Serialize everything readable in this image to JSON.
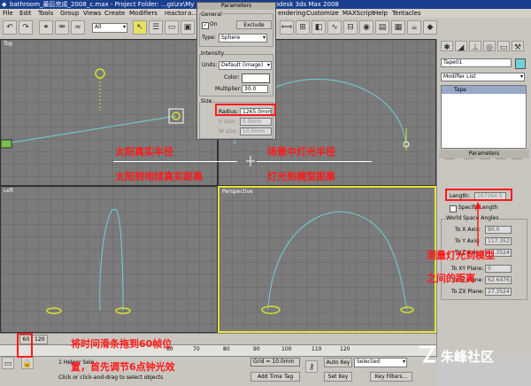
{
  "window": {
    "title": "bathroom_最后完成_2008_c.max - Project Folder: ...gs\\zx\\My Documents\\3dsmax - Autodesk 3ds Max 2008"
  },
  "menus": [
    "File",
    "Edit",
    "Tools",
    "Group",
    "Views",
    "Create",
    "Modifiers",
    "reactor",
    "a...",
    "endering",
    "Customize",
    "MAXScript",
    "Help",
    "Tentacles"
  ],
  "toolbar": {
    "selection_filter": "All"
  },
  "viewports": {
    "top": {
      "label": "Top"
    },
    "left": {
      "label": "Left"
    },
    "perspective": {
      "label": "Perspective"
    }
  },
  "light_params": {
    "title": "Parameters",
    "general": {
      "group": "General",
      "on_label": "On",
      "exclude_label": "Exclude",
      "type_label": "Type:",
      "type_value": "Sphere"
    },
    "intensity": {
      "group": "Intensity",
      "units_label": "Units:",
      "units_value": "Default (image)",
      "color_label": "Color:",
      "multiplier_label": "Multiplier:",
      "multiplier_value": "30.0"
    },
    "size": {
      "group": "Size",
      "radius_label": "Radius:",
      "radius_value": "1265.0mm",
      "vsize_label": "V size:",
      "vsize_value": "0.0mm",
      "wsize_label": "W size:",
      "wsize_value": "10.0mm"
    }
  },
  "command_panel": {
    "object_name": "Tape01",
    "modifier_list": "Modifier List",
    "stack_item": "Tape",
    "params_title": "Parameters",
    "length_label": "Length:",
    "length_value": "267064.5",
    "specify_length_label": "Specify Length",
    "wsa_group": "World Space Angles",
    "angles": [
      {
        "label": "To X Axis:",
        "value": "90.0"
      },
      {
        "label": "To Y Axis:",
        "value": "117.352"
      },
      {
        "label": "To Z Axis:",
        "value": "27.3524"
      },
      {
        "label": "To XY Plane:",
        "value": "0"
      },
      {
        "label": "To YZ Plane:",
        "value": "62.6476"
      },
      {
        "label": "To ZX Plane:",
        "value": "27.3524"
      }
    ]
  },
  "timeline": {
    "frame_label": "60 / 120",
    "ticks": [
      "60",
      "70",
      "80",
      "90",
      "100",
      "110",
      "120"
    ]
  },
  "statusbar": {
    "selected_label": "1 Helper Sele",
    "prompt": "Click or click-and-drag to select objects",
    "grid": "Grid = 10.0mm",
    "add_time_tag": "Add Time Tag",
    "auto_key": "Auto Key",
    "set_key": "Set Key",
    "selected_dropdown": "Selected",
    "key_filters": "Key Filters..."
  },
  "annotations": {
    "sun_radius": "太阳真实半径",
    "sun_distance": "太阳到地球真实距离",
    "scene_radius": "场景中灯光半径",
    "light_distance": "灯光到模型距离",
    "measure_1": "测量灯光到模型",
    "measure_2": "之间的距离",
    "timeline_note": "将时间滑条拖到60帧位",
    "timeline_note2": "置，首先调节6点钟光效",
    "watermark": "朱峰社区"
  },
  "colors": {
    "annotation_red": "#ff1a1a",
    "light_arc": "#6fd0d8",
    "sun_yellow": "#d8e030",
    "selection_yellow": "#e8e040",
    "title_blue": "#1a3f8f"
  }
}
